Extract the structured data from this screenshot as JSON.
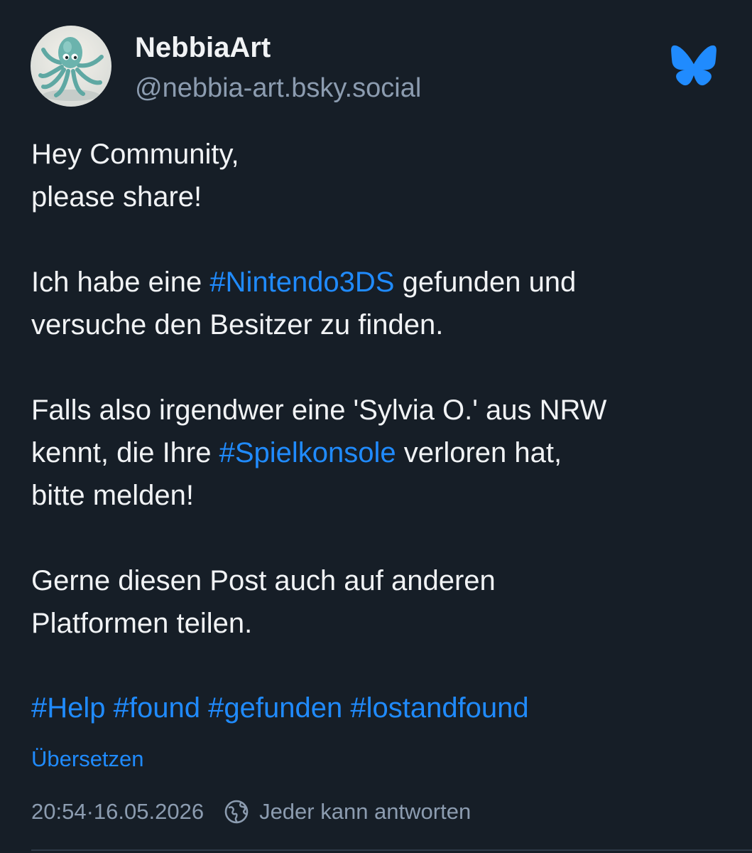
{
  "author": {
    "display_name": "NebbiaArt",
    "handle": "@nebbia-art.bsky.social"
  },
  "icons": {
    "app_logo": "bluesky-butterfly-icon",
    "reply_setting": "globe-icon"
  },
  "colors": {
    "background": "#161e27",
    "text": "#f1f3f5",
    "muted": "#8c9cb0",
    "link": "#208bfe"
  },
  "post": {
    "p1": {
      "line1": "Hey Community,",
      "line2": "please share!"
    },
    "p2": {
      "pre": "Ich habe eine ",
      "tag": "#Nintendo3DS",
      "post": " gefunden und",
      "line2": "versuche den Besitzer zu finden."
    },
    "p3": {
      "line1": "Falls also irgendwer eine 'Sylvia O.' aus NRW",
      "pre": "kennt, die Ihre ",
      "tag": "#Spielkonsole",
      "post": " verloren hat,",
      "line3": "bitte melden!"
    },
    "p4": {
      "line1": "Gerne diesen Post auch auf anderen",
      "line2": "Platformen teilen."
    },
    "hashtags": [
      "#Help",
      "#found",
      "#gefunden",
      "#lostandfound"
    ],
    "translate_label": "Übersetzen",
    "time": "20:54",
    "separator": " · ",
    "date": "16.05.2026",
    "reply_setting_label": "Jeder kann antworten"
  }
}
